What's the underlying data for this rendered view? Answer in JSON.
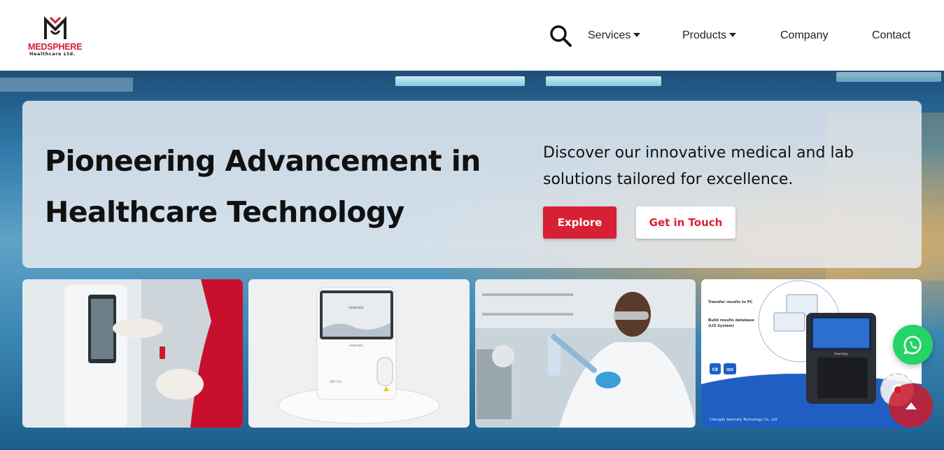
{
  "brand": {
    "name": "MEDSPHERE",
    "subname": "Healthcare Ltd.",
    "accent_color": "#d82035"
  },
  "nav": {
    "search_icon": "search-icon",
    "items": [
      {
        "label": "Services",
        "has_dropdown": true
      },
      {
        "label": "Products",
        "has_dropdown": true
      },
      {
        "label": "Company",
        "has_dropdown": false
      },
      {
        "label": "Contact",
        "has_dropdown": false
      }
    ]
  },
  "hero": {
    "title_line1": "Pioneering Advancement in",
    "title_line2": "Healthcare Technology",
    "subtitle": "Discover our innovative medical and lab solutions tailored for excellence.",
    "explore_label": "Explore",
    "touch_label": "Get in Touch"
  },
  "cards": {
    "card4": {
      "transfer_text": "Transfer results to PC",
      "build_text": "Build results database",
      "lis_text": "(LIS System)",
      "ce_text": "CE",
      "iso_text": "ISO",
      "device_text": "Seamaty",
      "company_text": "Chengdu Seamaty Technology Co., Ltd"
    },
    "card2": {
      "screen_brand": "seamaty",
      "device_brand": "seamaty",
      "model": "SMT-120"
    }
  },
  "floating": {
    "whatsapp_icon": "whatsapp-icon",
    "scroll_top_icon": "arrow-up-icon",
    "whatsapp_color": "#25d366"
  }
}
